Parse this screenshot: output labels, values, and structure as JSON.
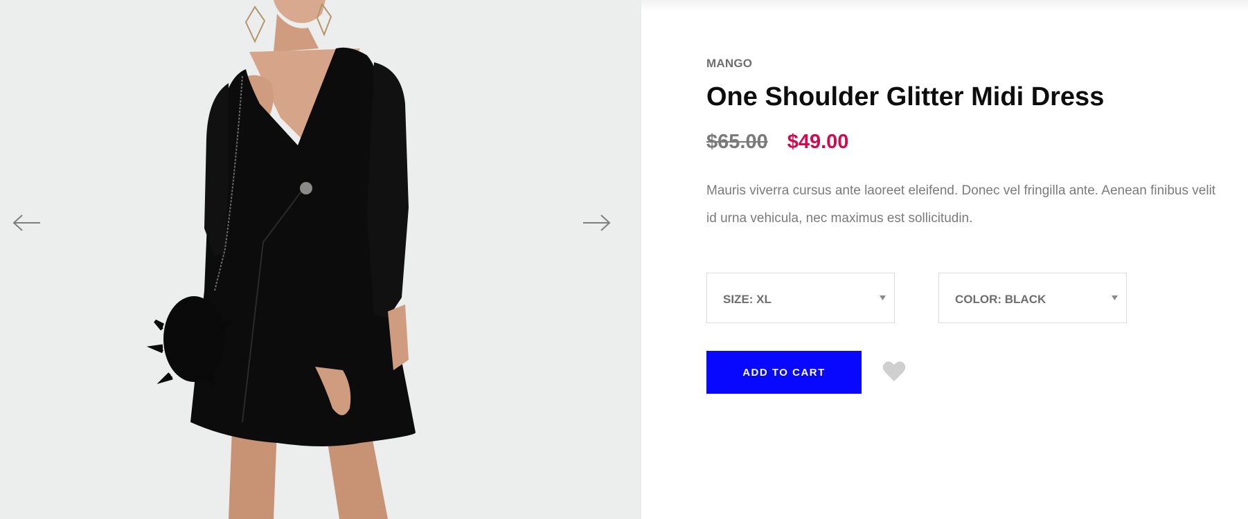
{
  "gallery": {
    "image": "model-in-black-wrap-dress-photo",
    "prev_icon": "arrow-left-icon",
    "next_icon": "arrow-right-icon"
  },
  "product": {
    "brand": "MANGO",
    "title": "One Shoulder Glitter Midi Dress",
    "price_old": "$65.00",
    "price_new": "$49.00",
    "description": "Mauris viverra cursus ante laoreet eleifend. Donec vel fringilla ante. Aenean finibus velit id urna vehicula, nec maximus est sollicitudin."
  },
  "options": {
    "size_label": "SIZE: XL",
    "color_label": "COLOR: BLACK",
    "caret_icon": "caret-down-icon"
  },
  "actions": {
    "add_to_cart": "ADD TO CART",
    "wishlist_icon": "heart-icon"
  },
  "colors": {
    "accent": "#0808fe",
    "sale_price": "#d4094d",
    "muted_text": "#7a7a7a",
    "heading": "#0d0d0d",
    "gallery_bg": "#eceeed",
    "wishlist": "#cfcfcf"
  }
}
